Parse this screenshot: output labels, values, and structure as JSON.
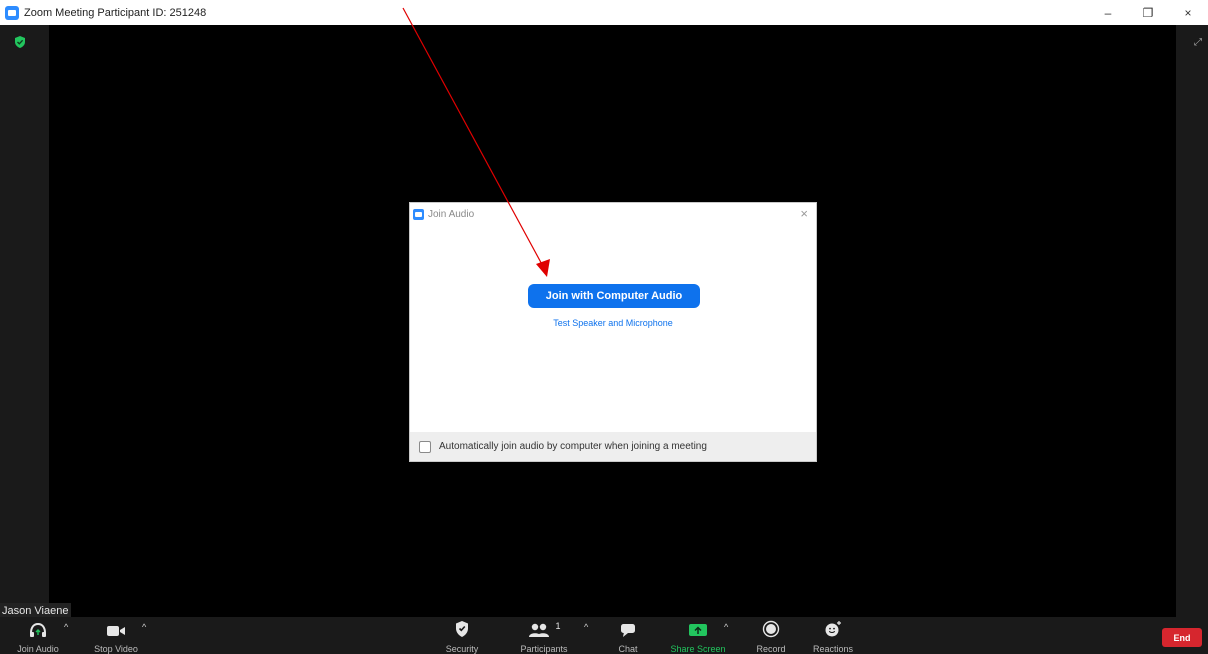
{
  "window": {
    "title": "Zoom Meeting Participant ID: 251248",
    "minimize": "–",
    "restore": "❐",
    "close": "×"
  },
  "participant": {
    "name": "Jason Viaene"
  },
  "dialog": {
    "title": "Join Audio",
    "close": "×",
    "primary_button": "Join with Computer Audio",
    "test_link": "Test Speaker and Microphone",
    "auto_join_label": "Automatically join audio by computer when joining a meeting",
    "auto_join_checked": false
  },
  "toolbar": {
    "join_audio": "Join Audio",
    "stop_video": "Stop Video",
    "security": "Security",
    "participants": "Participants",
    "participants_count": "1",
    "chat": "Chat",
    "share_screen": "Share Screen",
    "record": "Record",
    "reactions": "Reactions",
    "end": "End",
    "caret": "^"
  },
  "colors": {
    "accent": "#0e72ed",
    "share_green": "#22c55e",
    "end_red": "#d6262e",
    "annotation_arrow": "#e00000"
  }
}
